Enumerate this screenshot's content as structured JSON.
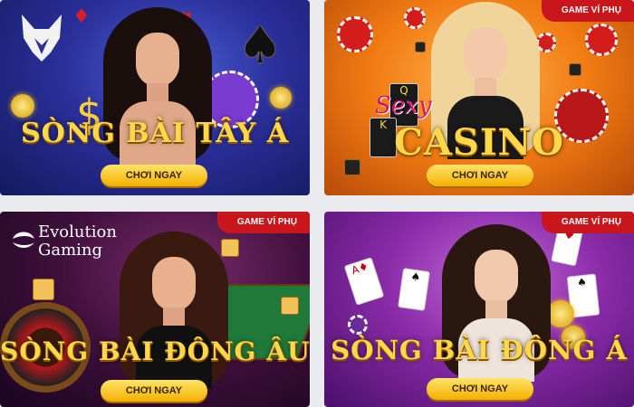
{
  "colors": {
    "title_gold": "#ffd84a",
    "button_gold": "#f4b100",
    "badge_red": "#c9161d",
    "page_bg": "#e9ebef"
  },
  "cards": [
    {
      "title": "SÒNG BÀI TÂY Á",
      "button": "CHƠI NGAY",
      "logo_icon": "fox-logo-icon"
    },
    {
      "title_script": "Sexy",
      "title": "CASINO",
      "button": "CHƠI NGAY",
      "badge": "GAME VÍ PHỤ"
    },
    {
      "logo_line1": "Evolution",
      "logo_line2": "Gaming",
      "title": "SÒNG BÀI ĐÔNG ÂU",
      "button": "CHƠI NGAY",
      "badge": "GAME VÍ PHỤ",
      "logo_icon": "evolution-logo-icon"
    },
    {
      "title": "SÒNG BÀI ĐÔNG Á",
      "button": "CHƠI NGAY",
      "badge": "GAME VÍ PHỤ"
    }
  ]
}
